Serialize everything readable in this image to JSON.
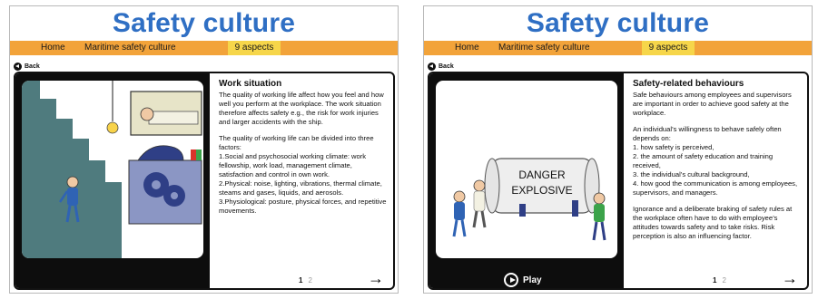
{
  "panels": [
    {
      "brand_title": "Safety culture",
      "nav": {
        "home": "Home",
        "maritime": "Maritime safety culture",
        "aspects": "9 aspects"
      },
      "back_label": "Back",
      "title": "Work situation",
      "paragraphs": [
        "The quality of working life affect how you feel and how well you perform at the workplace. The work situation therefore affects safety e.g., the risk for work injuries and larger accidents with the ship.",
        "The quality of working life can be divided into three factors:"
      ],
      "factors": [
        "1.Social and psychosocial working climate: work fellowship, work load, management climate, satisfaction and control in own work.",
        "2.Physical: noise, lighting, vibrations, thermal climate, steams and gases, liquids, and aerosols.",
        "3.Physiological: posture, physical forces, and repetitive movements."
      ],
      "pager": {
        "p1": "1",
        "p2": "2"
      },
      "next": "→"
    },
    {
      "brand_title": "Safety culture",
      "nav": {
        "home": "Home",
        "maritime": "Maritime safety culture",
        "aspects": "9 aspects"
      },
      "back_label": "Back",
      "title": "Safety-related behaviours",
      "paragraphs": [
        "Safe behaviours among employees and supervisors are important in order to achieve good safety at the workplace.",
        "An individual’s willingness to behave safely often depends on:"
      ],
      "factors": [
        "1. how safety is perceived,",
        "2. the amount of safety education and training received,",
        "3. the individual’s cultural background,",
        "4. how good the communication is among employees, supervisors, and managers."
      ],
      "closing": "Ignorance and a deliberate braking of safety rules at the workplace often have to do with employee’s attitudes towards safety and to take risks. Risk perception is also an influencing factor.",
      "sign_line1": "DANGER",
      "sign_line2": "EXPLOSIVE",
      "play_label": "Play",
      "pager": {
        "p1": "1",
        "p2": "2"
      },
      "next": "→"
    }
  ]
}
